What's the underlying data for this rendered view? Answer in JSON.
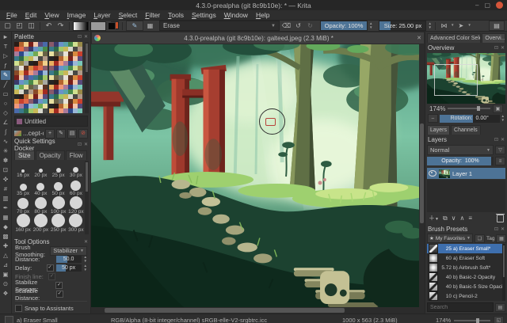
{
  "window": {
    "title": "4.3.0-prealpha (git 8c9b10e): * — Krita",
    "minimize": "–",
    "maximize": "▢"
  },
  "menu": {
    "items": [
      "File",
      "Edit",
      "View",
      "Image",
      "Layer",
      "Select",
      "Filter",
      "Tools",
      "Settings",
      "Window",
      "Help"
    ]
  },
  "toolbar": {
    "blend_mode": "Erase",
    "opacity": "Opacity: 100%",
    "size": "Size: 25.00 px"
  },
  "toolbox": {
    "selected": "freehand-brush",
    "tools": [
      {
        "name": "select-shapes",
        "glyph": "►"
      },
      {
        "name": "text",
        "glyph": "T"
      },
      {
        "name": "edit-shapes",
        "glyph": "▷"
      },
      {
        "name": "calligraphy",
        "glyph": "ƒ"
      },
      {
        "name": "freehand-brush",
        "glyph": "✎"
      },
      {
        "name": "line",
        "glyph": "╱"
      },
      {
        "name": "rectangle",
        "glyph": "▭"
      },
      {
        "name": "ellipse",
        "glyph": "○"
      },
      {
        "name": "polygon",
        "glyph": "◇"
      },
      {
        "name": "polyline",
        "glyph": "∠"
      },
      {
        "name": "bezier-curve",
        "glyph": "∫"
      },
      {
        "name": "freehand-path",
        "glyph": "∿"
      },
      {
        "name": "dynamic-brush",
        "glyph": "✳"
      },
      {
        "name": "multibrush",
        "glyph": "✽"
      },
      {
        "name": "transform",
        "glyph": "⊡"
      },
      {
        "name": "move",
        "glyph": "✜"
      },
      {
        "name": "crop",
        "glyph": "#"
      },
      {
        "name": "gradient",
        "glyph": "▥"
      },
      {
        "name": "color-sampler",
        "glyph": "✒"
      },
      {
        "name": "pattern-edit",
        "glyph": "▦"
      },
      {
        "name": "fill",
        "glyph": "◆"
      },
      {
        "name": "enclose-fill",
        "glyph": "▩"
      },
      {
        "name": "smart-patch",
        "glyph": "✚"
      },
      {
        "name": "assistants",
        "glyph": "△"
      },
      {
        "name": "measure",
        "glyph": "⊿"
      },
      {
        "name": "reference-images",
        "glyph": "▣"
      },
      {
        "name": "zoom-tool",
        "glyph": "⊙"
      },
      {
        "name": "pan-tool",
        "glyph": "❖"
      }
    ]
  },
  "palette": {
    "title": "Palette",
    "current_name": "Untitled",
    "chip_color": "#8a5a7d",
    "file_name": "...cept-cookie",
    "colors": [
      "#2b1c16",
      "#5a3322",
      "#8a4a28",
      "#b5632e",
      "#d98a3f",
      "#e8b060",
      "#f0d08a",
      "#c9402e",
      "#a32a20",
      "#7a1f1a",
      "#e06a4a",
      "#f0987a",
      "#f2c4a8",
      "#8a5a6a",
      "#aa7a9a",
      "#5a4a7a",
      "#3a3a6a",
      "#2e4a8a",
      "#4a6aaa",
      "#6a92c8",
      "#9ab8d8",
      "#3a7a8a",
      "#5aa3a8",
      "#7ac8b8",
      "#2e6a4a",
      "#4a8a4a",
      "#72aa52",
      "#a2c868",
      "#d0e090",
      "#e8e0a0",
      "#c8b858",
      "#988a48",
      "#686244",
      "#d8d8cc",
      "#a8a8a0",
      "#787870",
      "#484844",
      "#242424",
      "#e8e2d8",
      "#b09a88"
    ]
  },
  "qs": {
    "title": "Quick Settings Docker",
    "tabs": [
      "Size",
      "Opacity",
      "Flow"
    ],
    "sizes": [
      "16 px",
      "20 px",
      "25 px",
      "30 px",
      "35 px",
      "40 px",
      "50 px",
      "60 px",
      "70 px",
      "80 px",
      "100 px",
      "120 px",
      "160 px",
      "200 px",
      "250 px",
      "300 px"
    ]
  },
  "to": {
    "title": "Tool Options",
    "smoothing_label": "Brush Smoothing:",
    "smoothing_value": "Stabilizer",
    "distance_label": "Distance:",
    "distance_value": "50.0",
    "delay_label": "Delay:",
    "delay_value": "50 px",
    "finish_label": "Finish line:",
    "sensors_label": "Stabilize Sensors:",
    "scalable_label": "Scalable Distance:",
    "snap_label": "Snap to Assistants"
  },
  "canvas": {
    "doc_title": "4.3.0-prealpha (git 8c9b10e): galteed.jpeg (2.3 MiB) *"
  },
  "rp": {
    "tabs": [
      "Advanced Color Selec…",
      "Overvi…"
    ],
    "overview": {
      "title": "Overview",
      "zoom": "174%",
      "rotation_label": "Rotation:",
      "rotation_value": "0.00°"
    },
    "layer_tabs": [
      "Layers",
      "Channels"
    ],
    "layers": {
      "title": "Layers",
      "blend": "Normal",
      "opacity_label": "Opacity:",
      "opacity_value": "100%",
      "rows": [
        {
          "name": "Layer 1"
        }
      ]
    },
    "presets": {
      "title": "Brush Presets",
      "filter": "My Favorites",
      "tag": "Tag",
      "search_placeholder": "Search",
      "items": [
        {
          "size": "25",
          "name": "a) Eraser Small*"
        },
        {
          "size": "60",
          "name": "a) Eraser Soft"
        },
        {
          "size": "5.72",
          "name": "b) Airbrush Soft*"
        },
        {
          "size": "40",
          "name": "b) Basic-2 Opacity"
        },
        {
          "size": "40",
          "name": "b) Basic-5 Size Opacity"
        },
        {
          "size": "10",
          "name": "c) Pencil-2"
        }
      ]
    }
  },
  "status": {
    "brush": "a) Eraser Small",
    "profile": "RGB/Alpha (8-bit integer/channel)  sRGB-elle-V2-srgbtrc.icc",
    "size": "1000 x 563 (2.3 MiB)",
    "zoom": "174%"
  },
  "colors": {
    "accent": "#4d7396",
    "selection": "#3e6fae"
  }
}
